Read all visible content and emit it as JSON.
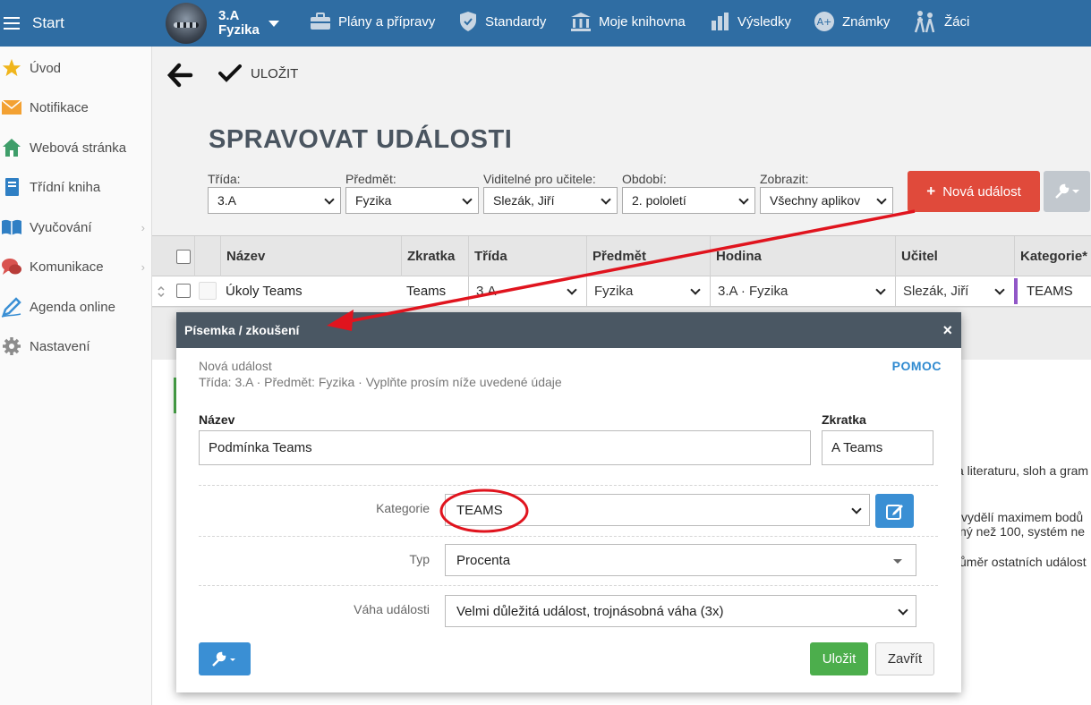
{
  "topbar": {
    "start_label": "Start",
    "class_name": "3.A",
    "subject_name": "Fyzika",
    "nav": [
      {
        "label": "Plány a přípravy",
        "icon": "briefcase-icon"
      },
      {
        "label": "Standardy",
        "icon": "shield-icon"
      },
      {
        "label": "Moje knihovna",
        "icon": "library-icon"
      },
      {
        "label": "Výsledky",
        "icon": "bar-chart-icon"
      },
      {
        "label": "Známky",
        "icon": "grade-icon"
      },
      {
        "label": "Žáci",
        "icon": "students-icon"
      }
    ]
  },
  "sidebar": {
    "items": [
      {
        "label": "Úvod",
        "icon": "star-icon"
      },
      {
        "label": "Notifikace",
        "icon": "envelope-icon"
      },
      {
        "label": "Webová stránka",
        "icon": "home-icon"
      },
      {
        "label": "Třídní kniha",
        "icon": "book-icon"
      },
      {
        "label": "Vyučování",
        "icon": "open-book-icon"
      },
      {
        "label": "Komunikace",
        "icon": "chat-icon"
      },
      {
        "label": "Agenda online",
        "icon": "pencil-icon"
      },
      {
        "label": "Nastavení",
        "icon": "gear-icon"
      }
    ],
    "chevron": "›"
  },
  "toolbar": {
    "save_label": "ULOŽIT"
  },
  "page": {
    "title": "SPRAVOVAT UDÁLOSTI"
  },
  "filters": [
    {
      "label": "Třída:",
      "value": "3.A"
    },
    {
      "label": "Předmět:",
      "value": "Fyzika"
    },
    {
      "label": "Viditelné pro učitele:",
      "value": "Slezák, Jiří"
    },
    {
      "label": "Období:",
      "value": "2. pololetí"
    },
    {
      "label": "Zobrazit:",
      "value": "Všechny aplikov"
    }
  ],
  "new_event_button": "Nová událost",
  "table": {
    "headers": [
      "Název",
      "Zkratka",
      "Třída",
      "Předmět",
      "Hodina",
      "Učitel",
      "Kategorie*"
    ],
    "row": {
      "nazev": "Úkoly Teams",
      "zkratka": "Teams",
      "trida": "3.A",
      "predmet": "Fyzika",
      "hodina": "3.A · Fyzika",
      "ucitel": "Slezák, Jiří",
      "kategorie": "TEAMS"
    }
  },
  "background_text": {
    "line1": "a literaturu, sloh a gram",
    "line2": "vydělí maximem bodů",
    "line3": "ný než 100, systém ne",
    "line4": "ůměr ostatních událost"
  },
  "modal": {
    "title": "Písemka / zkoušení",
    "close": "×",
    "subtitle1": "Nová událost",
    "subtitle2": "Třída: 3.A · Předmět: Fyzika · Vyplňte prosím níže uvedené údaje",
    "help": "POMOC",
    "name_label": "Název",
    "name_value": "Podmínka Teams",
    "abbr_label": "Zkratka",
    "abbr_value": "A Teams",
    "category_label": "Kategorie",
    "category_value": "TEAMS",
    "type_label": "Typ",
    "type_value": "Procenta",
    "weight_label": "Váha události",
    "weight_value": "Velmi důležitá událost, trojnásobná váha (3x)",
    "save_button": "Uložit",
    "close_button": "Zavřít"
  },
  "colors": {
    "topbar": "#2f6da3",
    "danger": "#e04a3b",
    "primary": "#3a8fd4",
    "success": "#4cae4c",
    "modal_header": "#4a5763",
    "annotation": "#e0141e",
    "category_marker": "#9157c7"
  }
}
